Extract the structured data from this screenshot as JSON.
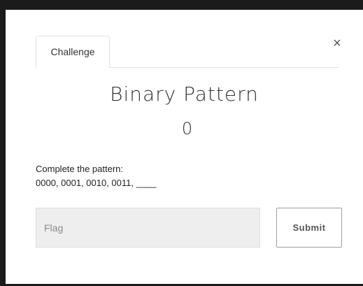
{
  "modal": {
    "tab_label": "Challenge",
    "close_glyph": "×",
    "title": "Binary Pattern",
    "value": "0",
    "description_lines": [
      "Complete the pattern:",
      "0000, 0001, 0010, 0011, ____"
    ],
    "flag_placeholder": "Flag",
    "submit_label": "Submit"
  },
  "icons": {
    "close": "close-icon"
  },
  "colors": {
    "backdrop": "#1b1b1b",
    "modal_bg": "#ffffff",
    "input_bg": "#eeeeee"
  }
}
